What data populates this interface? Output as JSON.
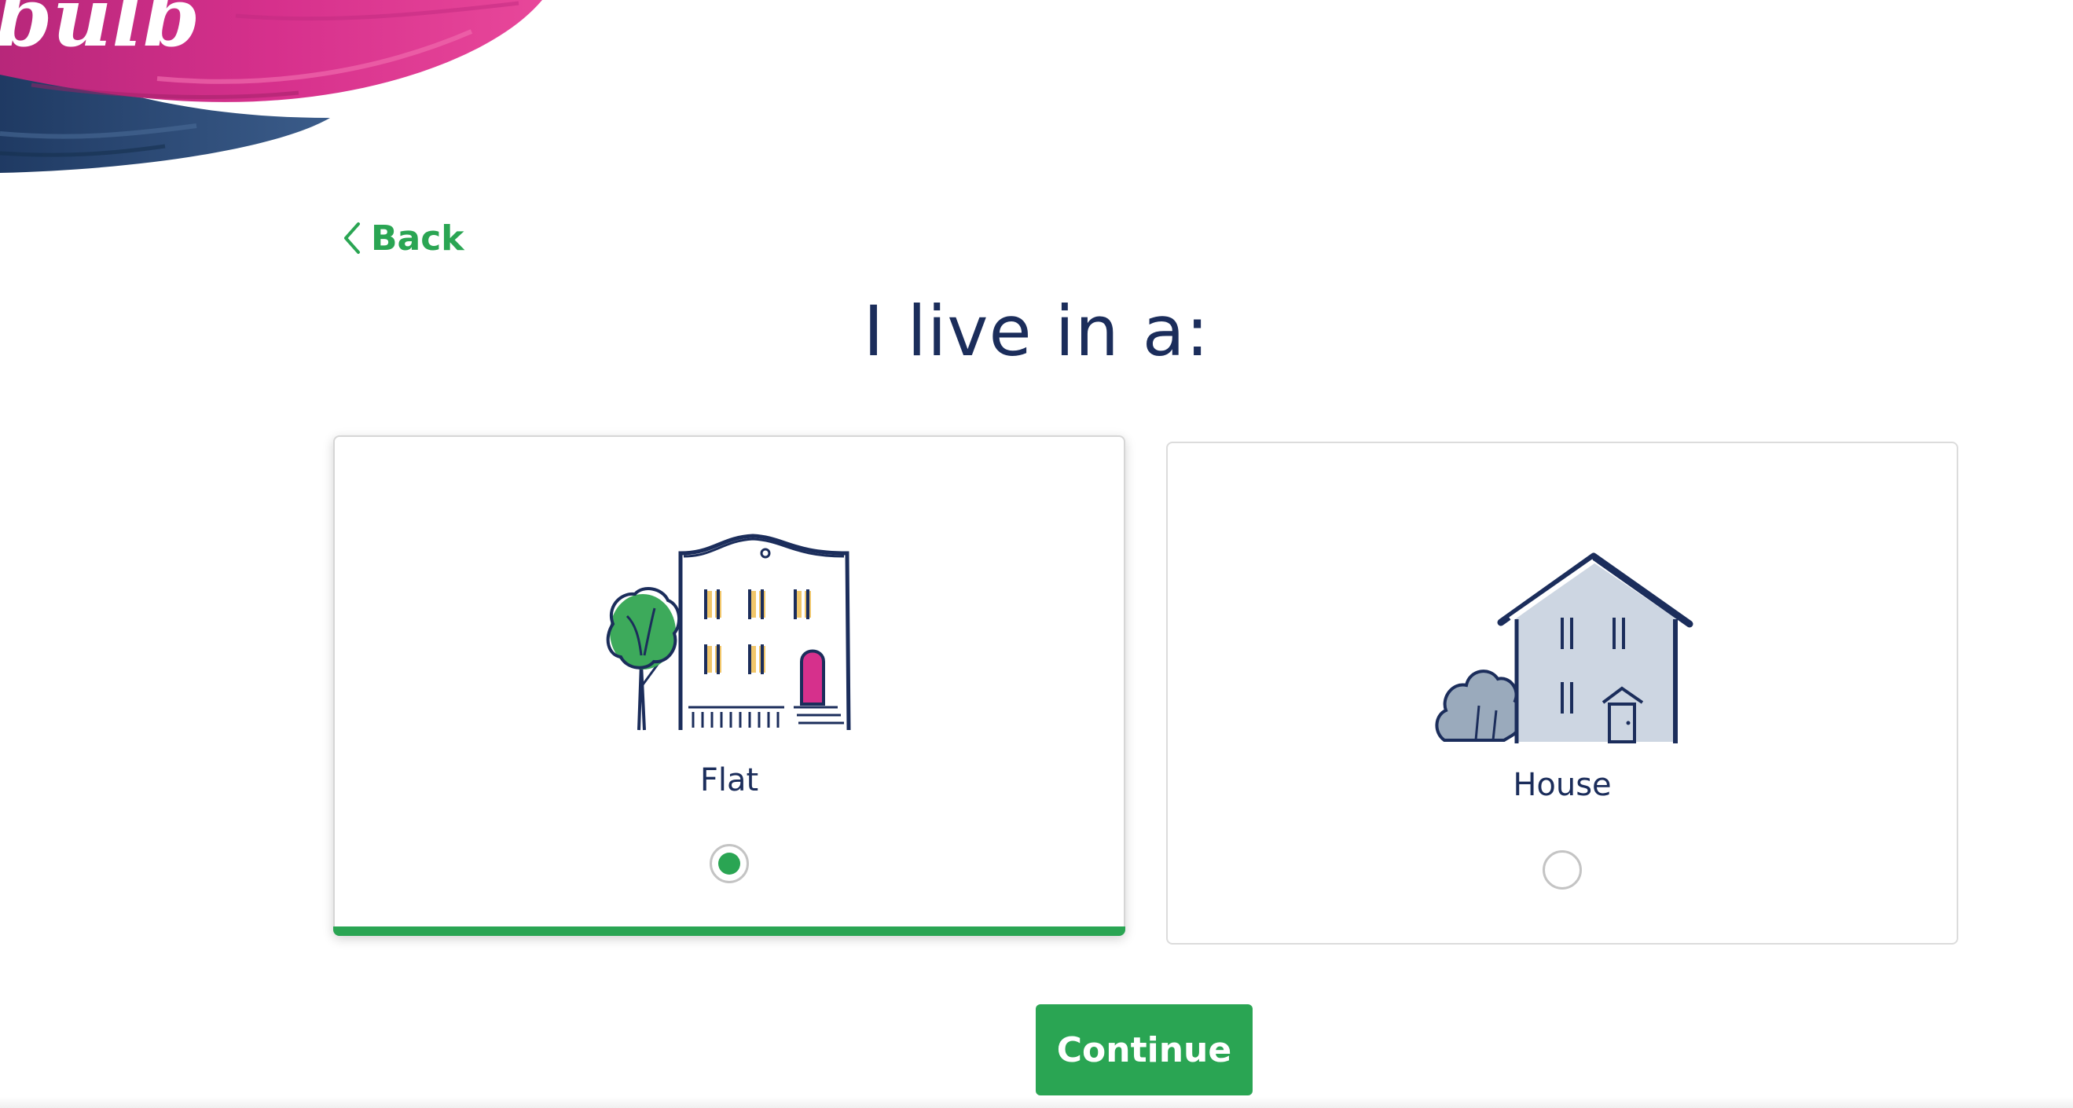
{
  "brand": {
    "logo_text": "bulb",
    "colors": {
      "pink": "#d6308c",
      "magenta": "#b7277a",
      "navy": "#27426b"
    }
  },
  "nav": {
    "back_label": "Back",
    "back_icon": "chevron-left-icon"
  },
  "question": {
    "title": "I live in a:"
  },
  "options": [
    {
      "label": "Flat",
      "icon": "flat-building-icon",
      "selected": true
    },
    {
      "label": "House",
      "icon": "house-icon",
      "selected": false
    }
  ],
  "actions": {
    "continue_label": "Continue"
  },
  "theme": {
    "accent": "#2aa553",
    "text": "#1b2d5b",
    "card_border": "#dcdcdc"
  }
}
